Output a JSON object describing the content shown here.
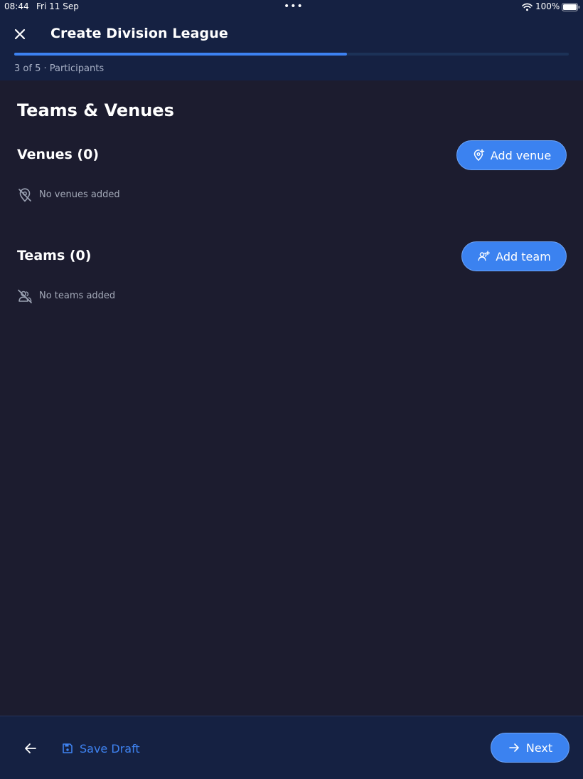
{
  "status_bar": {
    "time": "08:44",
    "date": "Fri 11 Sep",
    "battery": "100%"
  },
  "header": {
    "title": "Create Division League",
    "step_label": "3 of 5 · Participants",
    "progress": 0.6
  },
  "main": {
    "section_title": "Teams & Venues",
    "venues": {
      "title": "Venues (0)",
      "empty_text": "No venues added",
      "add_label": "Add venue"
    },
    "teams": {
      "title": "Teams (0)",
      "empty_text": "No teams added",
      "add_label": "Add team"
    }
  },
  "footer": {
    "save_draft_label": "Save Draft",
    "next_label": "Next"
  },
  "colors": {
    "accent": "#3b82f0",
    "background": "#1c1c2f",
    "header": "#152142"
  }
}
